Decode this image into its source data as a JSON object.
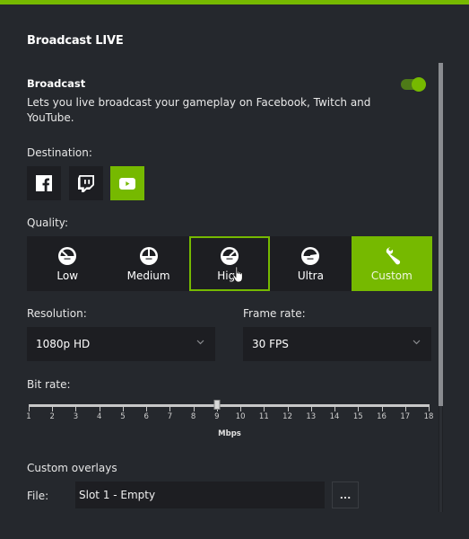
{
  "header": {
    "title": "Broadcast LIVE"
  },
  "broadcast": {
    "heading": "Broadcast",
    "description": "Lets you live broadcast your gameplay on Facebook, Twitch and YouTube.",
    "enabled": true
  },
  "destination": {
    "label": "Destination:",
    "options": [
      {
        "name": "Facebook",
        "icon": "facebook-icon",
        "selected": false
      },
      {
        "name": "Twitch",
        "icon": "twitch-icon",
        "selected": false
      },
      {
        "name": "YouTube",
        "icon": "youtube-icon",
        "selected": true
      }
    ]
  },
  "quality": {
    "label": "Quality:",
    "options": [
      {
        "label": "Low",
        "icon": "gauge-low-icon",
        "state": "normal"
      },
      {
        "label": "Medium",
        "icon": "gauge-medium-icon",
        "state": "normal"
      },
      {
        "label": "High",
        "icon": "gauge-high-icon",
        "state": "hover"
      },
      {
        "label": "Ultra",
        "icon": "gauge-ultra-icon",
        "state": "normal"
      },
      {
        "label": "Custom",
        "icon": "wrench-icon",
        "state": "selected"
      }
    ]
  },
  "resolution": {
    "label": "Resolution:",
    "value": "1080p HD"
  },
  "frame_rate": {
    "label": "Frame rate:",
    "value": "30 FPS"
  },
  "bit_rate": {
    "label": "Bit rate:",
    "min": 1,
    "max": 18,
    "value": 9,
    "ticks": [
      "1",
      "2",
      "3",
      "4",
      "5",
      "6",
      "7",
      "8",
      "9",
      "10",
      "11",
      "12",
      "13",
      "14",
      "15",
      "16",
      "17",
      "18"
    ],
    "unit": "Mbps"
  },
  "overlays": {
    "heading": "Custom overlays",
    "file_label": "File:",
    "file_value": "Slot 1 - Empty",
    "browse_label": "..."
  },
  "colors": {
    "accent": "#76b900",
    "background": "#25282d",
    "control_bg": "#1d1e22"
  }
}
